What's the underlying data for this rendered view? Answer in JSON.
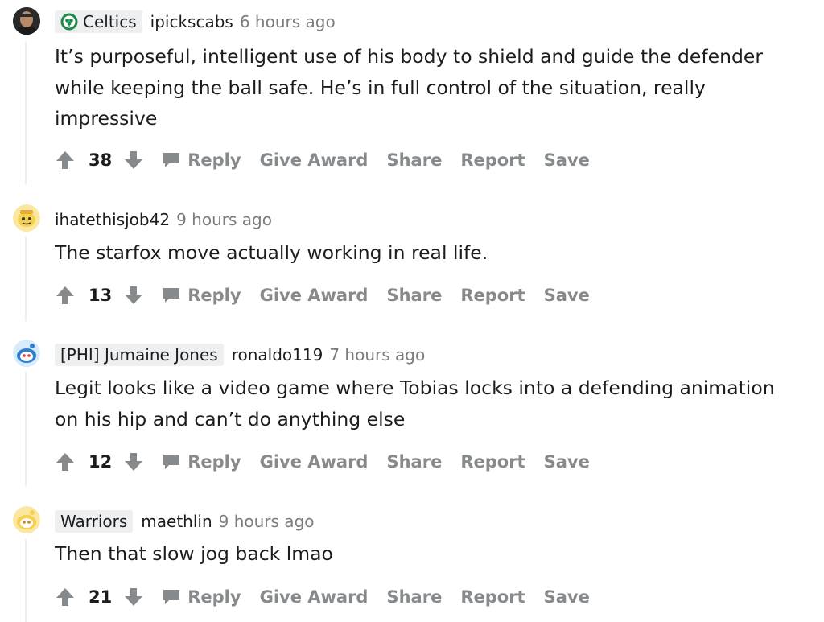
{
  "comments": [
    {
      "flair": "Celtics",
      "author": "ipickscabs",
      "time": "6 hours ago",
      "body": "It’s purposeful, intelligent use of his body to shield and guide the defender while keeping the ball safe. He’s in full control of the situation, really impressive",
      "score": "38"
    },
    {
      "flair": "",
      "author": "ihatethisjob42",
      "time": "9 hours ago",
      "body": "The starfox move actually working in real life.",
      "score": "13"
    },
    {
      "flair": "[PHI] Jumaine Jones",
      "author": "ronaldo119",
      "time": "7 hours ago",
      "body": "Legit looks like a video game where Tobias locks into a defending animation on his hip and can’t do anything else",
      "score": "12"
    },
    {
      "flair": "Warriors",
      "author": "maethlin",
      "time": "9 hours ago",
      "body": "Then that slow jog back lmao",
      "score": "21"
    }
  ],
  "actions": {
    "reply": "Reply",
    "give_award": "Give Award",
    "share": "Share",
    "report": "Report",
    "save": "Save"
  },
  "colors": {
    "action_gray": "#878a8c",
    "flair_bg": "#edeff1",
    "celtics_green": "#1e8a4a",
    "snoo_yellow": "#f6d14a",
    "snoo_blue": "#2d7fd3"
  }
}
